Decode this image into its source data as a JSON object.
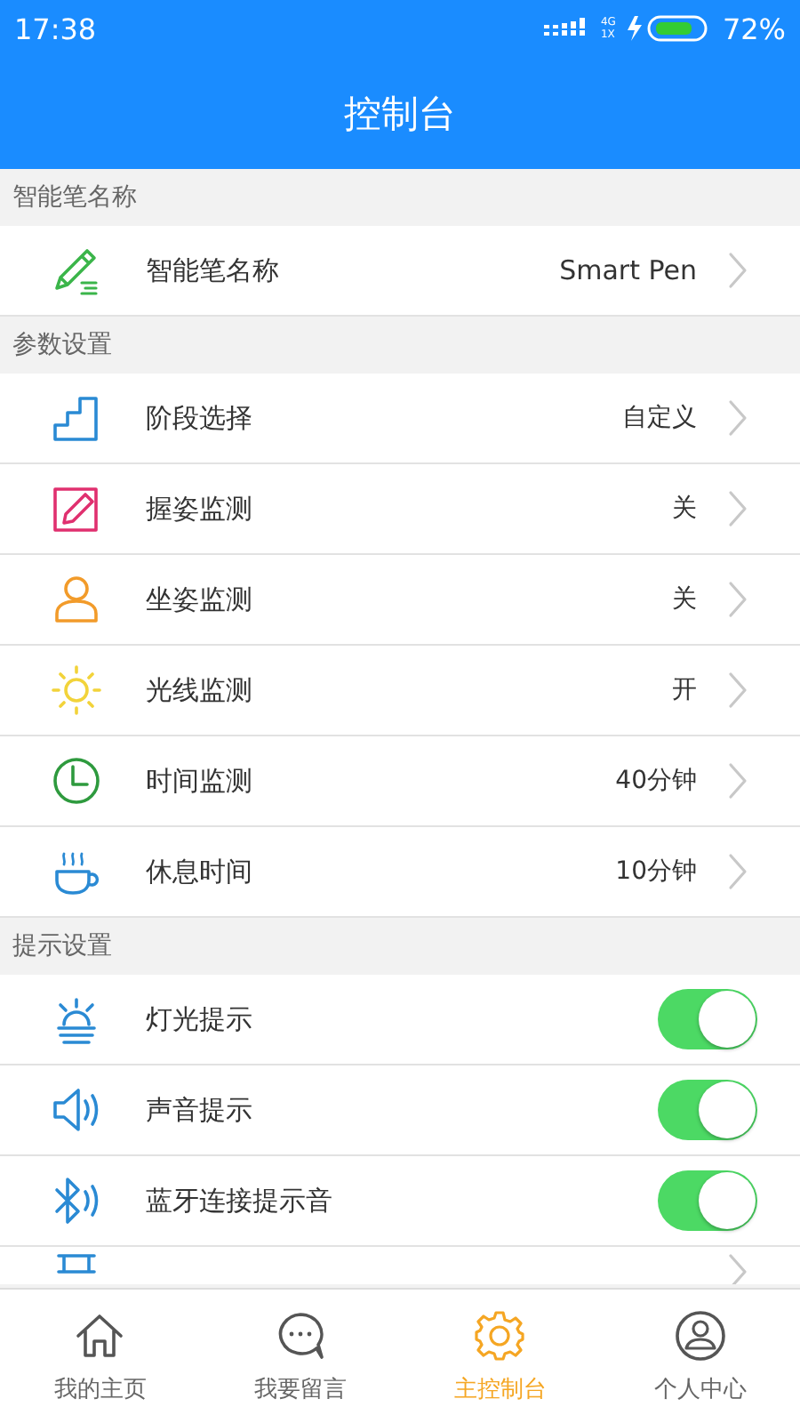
{
  "status_bar": {
    "time": "17:38",
    "network": "4G",
    "sim": "1X",
    "battery": "72%"
  },
  "title": "控制台",
  "sections": [
    {
      "title": "智能笔名称",
      "rows": [
        {
          "kind": "link",
          "label": "智能笔名称",
          "value": "Smart Pen"
        }
      ]
    },
    {
      "title": "参数设置",
      "rows": [
        {
          "kind": "link",
          "label": "阶段选择",
          "value": "自定义"
        },
        {
          "kind": "link",
          "label": "握姿监测",
          "value": "关"
        },
        {
          "kind": "link",
          "label": "坐姿监测",
          "value": "关"
        },
        {
          "kind": "link",
          "label": "光线监测",
          "value": "开"
        },
        {
          "kind": "link",
          "label": "时间监测",
          "value": "40分钟"
        },
        {
          "kind": "link",
          "label": "休息时间",
          "value": "10分钟"
        }
      ]
    },
    {
      "title": "提示设置",
      "rows": [
        {
          "kind": "toggle",
          "label": "灯光提示",
          "on": true
        },
        {
          "kind": "toggle",
          "label": "声音提示",
          "on": true
        },
        {
          "kind": "toggle",
          "label": "蓝牙连接提示音",
          "on": true
        },
        {
          "kind": "partial"
        }
      ]
    }
  ],
  "tabs": [
    {
      "label": "我的主页",
      "selected": false
    },
    {
      "label": "我要留言",
      "selected": false
    },
    {
      "label": "主控制台",
      "selected": true
    },
    {
      "label": "个人中心",
      "selected": false
    }
  ]
}
